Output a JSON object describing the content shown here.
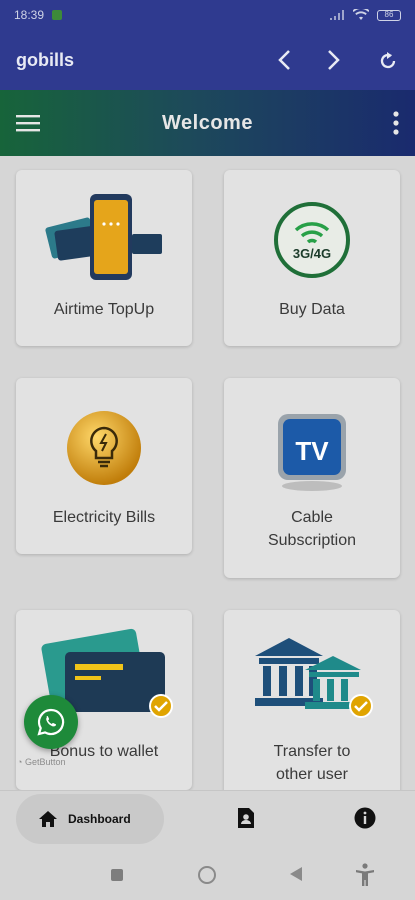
{
  "status_bar": {
    "time": "18:39",
    "battery": "86"
  },
  "browser": {
    "title": "gobills"
  },
  "app_bar": {
    "title": "Welcome"
  },
  "services": [
    {
      "label": "Airtime TopUp"
    },
    {
      "label": "Buy Data",
      "badge": "3G/4G"
    },
    {
      "label": "Electricity Bills"
    },
    {
      "label_line1": "Cable",
      "label_line2": "Subscription",
      "badge": "TV"
    },
    {
      "label": "Bonus to wallet"
    },
    {
      "label_line1": "Transfer to",
      "label_line2": "other user"
    }
  ],
  "getbutton": {
    "text": "GetButton"
  },
  "bottom_nav": {
    "dashboard_label": "Dashboard"
  },
  "colors": {
    "primary": "#2f3a8f",
    "accent_green": "#1e8a3a",
    "gold": "#e0a400"
  }
}
